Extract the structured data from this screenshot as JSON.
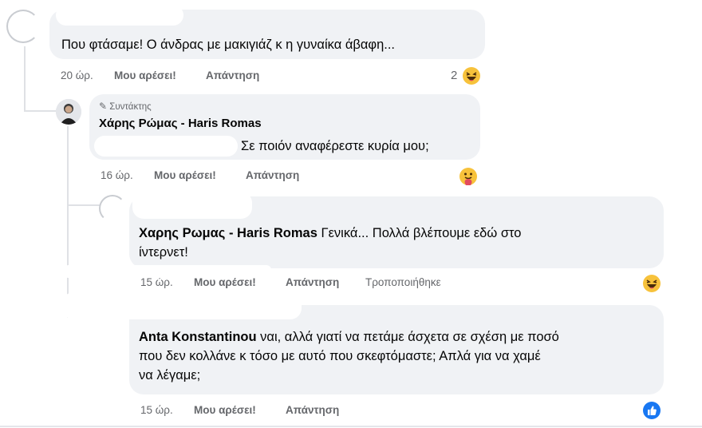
{
  "comment1": {
    "text": "Που φτάσαμε! Ο άνδρας με μακιγιάζ κ η γυναίκα άβαφη...",
    "time": "20 ώρ.",
    "like": "Μου αρέσει!",
    "reply": "Απάντηση",
    "reaction_count": "2",
    "reaction_icon": "haha-emoji-icon"
  },
  "reply1": {
    "badge": "Συντάκτης",
    "author": "Χάρης Ρώμας - Haris Romas",
    "text": "Σε ποιόν αναφέρεστε κυρία μου;",
    "time": "16 ώρ.",
    "like": "Μου αρέσει!",
    "reply": "Απάντηση",
    "reaction_icon": "care-emoji-icon"
  },
  "reply2": {
    "author": "Χαρης Ρωμας - Haris Romas",
    "text_line1": " Γενικά... Πολλά βλέπουμε εδώ στο",
    "text_line2": "ίντερνετ!",
    "time": "15 ώρ.",
    "like": "Μου αρέσει!",
    "reply": "Απάντηση",
    "edited": "Τροποποιήθηκε",
    "reaction_icon": "haha-emoji-icon"
  },
  "reply3": {
    "author": "Anta Konstantinou",
    "text_line1": " ναι, αλλά γιατί να πετάμε άσχετα σε σχέση με ποσό",
    "text_line2": "που δεν κολλάνε κ τόσο με αυτό που σκεφτόμαστε; Απλά για να χαμέ",
    "text_line3": "να λέγαμε;",
    "time": "15 ώρ.",
    "like": "Μου αρέσει!",
    "reply": "Απάντηση",
    "reaction_icon": "like-icon"
  },
  "colors": {
    "bubble": "#f0f2f5",
    "meta_text": "#65676b",
    "like_blue": "#1877f2",
    "emoji_yellow": "#f7c23b"
  }
}
